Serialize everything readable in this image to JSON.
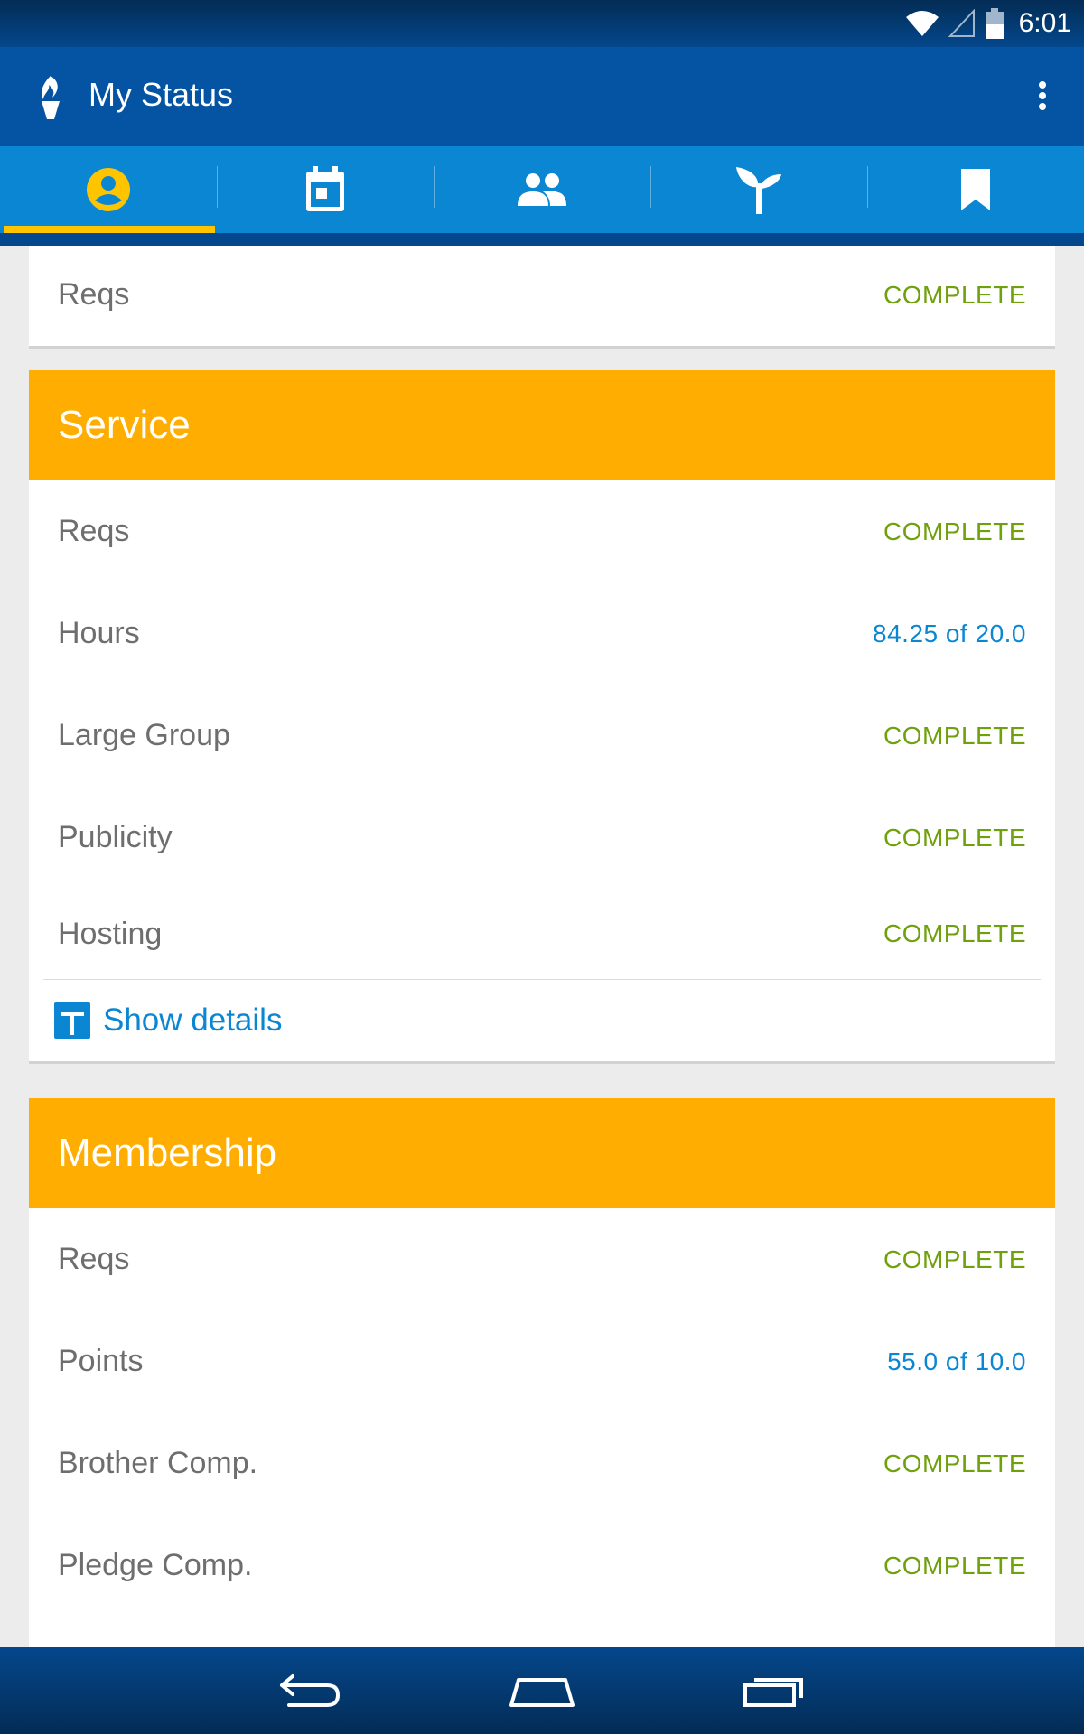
{
  "status_bar": {
    "time": "6:01",
    "icons": [
      "wifi-icon",
      "signal-icon",
      "battery-icon"
    ]
  },
  "app_bar": {
    "title": "My Status",
    "logo": "torch-logo-icon",
    "menu_icon": "overflow-menu-icon"
  },
  "tabs": [
    {
      "name": "profile",
      "icon": "person-icon",
      "active": true
    },
    {
      "name": "calendar",
      "icon": "calendar-icon",
      "active": false
    },
    {
      "name": "people",
      "icon": "group-icon",
      "active": false
    },
    {
      "name": "growth",
      "icon": "sprout-icon",
      "active": false
    },
    {
      "name": "bookmarks",
      "icon": "bookmark-icon",
      "active": false
    }
  ],
  "colors": {
    "primary": "#0454a3",
    "tab_bar": "#0a86d3",
    "accent": "#ffc400",
    "section_header": "#ffad00",
    "complete": "#6fa10c",
    "progress": "#0a86d3"
  },
  "top_card": {
    "rows": [
      {
        "label": "Reqs",
        "value": "COMPLETE",
        "status": "complete"
      }
    ]
  },
  "service": {
    "title": "Service",
    "rows": [
      {
        "label": "Reqs",
        "value": "COMPLETE",
        "status": "complete"
      },
      {
        "label": "Hours",
        "value": "84.25 of 20.0",
        "status": "progress"
      },
      {
        "label": "Large Group",
        "value": "COMPLETE",
        "status": "complete"
      },
      {
        "label": "Publicity",
        "value": "COMPLETE",
        "status": "complete"
      },
      {
        "label": "Hosting",
        "value": "COMPLETE",
        "status": "complete"
      }
    ],
    "details_label": "Show details"
  },
  "membership": {
    "title": "Membership",
    "rows": [
      {
        "label": "Reqs",
        "value": "COMPLETE",
        "status": "complete"
      },
      {
        "label": "Points",
        "value": "55.0 of 10.0",
        "status": "progress"
      },
      {
        "label": "Brother Comp.",
        "value": "COMPLETE",
        "status": "complete"
      },
      {
        "label": "Pledge Comp.",
        "value": "COMPLETE",
        "status": "complete"
      }
    ]
  },
  "nav_bar": {
    "buttons": [
      "back-icon",
      "home-icon",
      "recents-icon"
    ]
  }
}
